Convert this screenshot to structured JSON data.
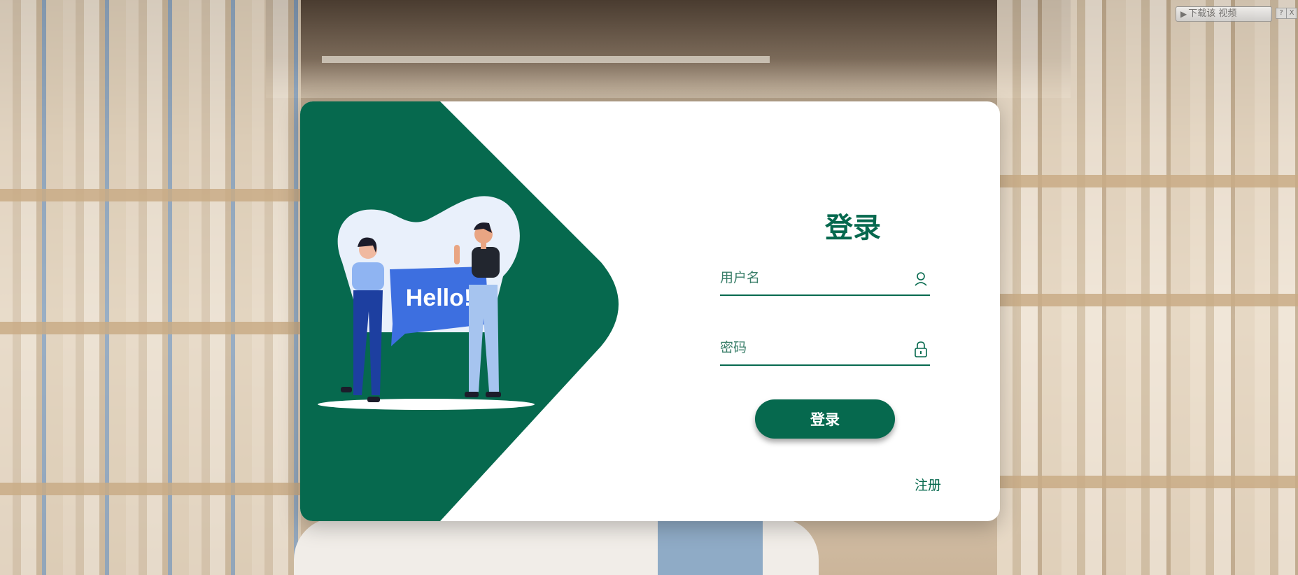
{
  "overlay": {
    "video_button_label": "下载该 视频",
    "help_label": "?",
    "close_label": "X"
  },
  "illustration": {
    "speech_text": "Hello!"
  },
  "login": {
    "title": "登录",
    "username_placeholder": "用户名",
    "password_placeholder": "密码",
    "submit_label": "登录",
    "register_label": "注册"
  },
  "colors": {
    "primary_green": "#06694e",
    "speech_blue": "#3d6fe0",
    "card_bg": "#ffffff"
  },
  "icons": {
    "username": "user-icon",
    "password": "lock-icon",
    "video": "play-icon"
  }
}
